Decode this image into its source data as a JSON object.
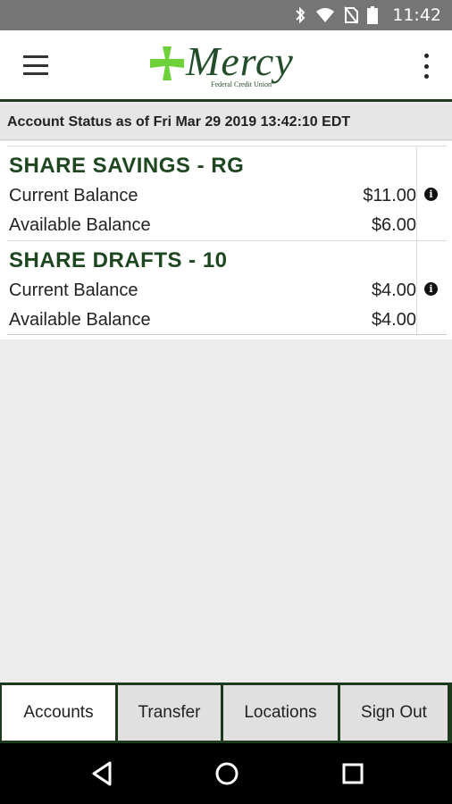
{
  "status_bar": {
    "time": "11:42"
  },
  "app": {
    "logo_name": "Mercy",
    "logo_sub": "Federal Credit Union"
  },
  "account_status": "Account Status as of Fri Mar 29 2019 13:42:10 EDT",
  "accounts": [
    {
      "title": "SHARE SAVINGS - RG",
      "current_label": "Current Balance",
      "current_value": "$11.00",
      "available_label": "Available Balance",
      "available_value": "$6.00"
    },
    {
      "title": "SHARE DRAFTS - 10",
      "current_label": "Current Balance",
      "current_value": "$4.00",
      "available_label": "Available Balance",
      "available_value": "$4.00"
    }
  ],
  "tabs": [
    {
      "label": "Accounts",
      "active": true
    },
    {
      "label": "Transfer",
      "active": false
    },
    {
      "label": "Locations",
      "active": false
    },
    {
      "label": "Sign Out",
      "active": false
    }
  ],
  "colors": {
    "brand_green": "#234d2a",
    "logo_cross": "#6fd13a",
    "status_bar": "#757575"
  },
  "icons": [
    "bluetooth-icon",
    "wifi-icon",
    "no-sim-icon",
    "battery-icon",
    "hamburger-menu-icon",
    "overflow-menu-icon",
    "info-icon",
    "back-icon",
    "home-icon",
    "recents-icon"
  ]
}
